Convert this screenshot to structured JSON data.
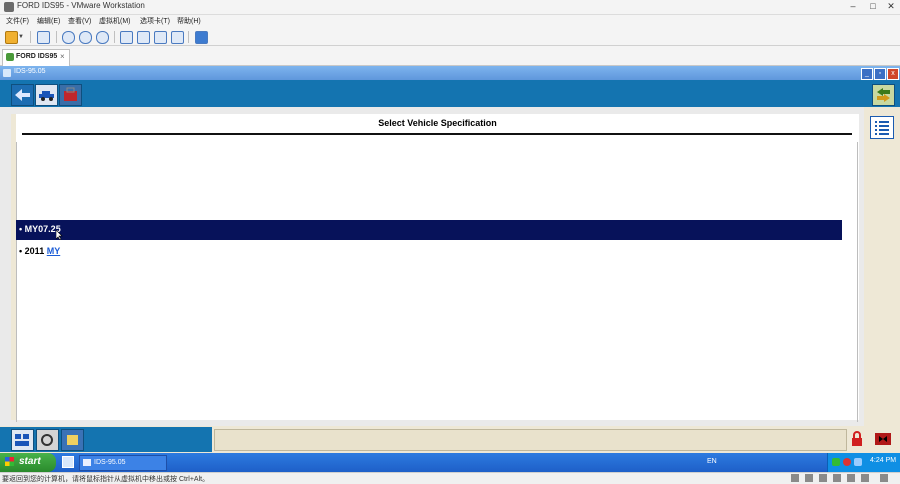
{
  "vmware": {
    "window_title": "FORD IDS95 - VMware Workstation",
    "menu": [
      "文件(F)",
      "编辑(E)",
      "查看(V)",
      "虚拟机(M)",
      "选项卡(T)",
      "帮助(H)"
    ],
    "tab_label": "FORD IDS95",
    "tab_close": "×",
    "status_text": "要返回到您的计算机，请将鼠标指针从虚拟机中移出或按 Ctrl+Alt。"
  },
  "guest": {
    "window_title": "IDS-95.05"
  },
  "ids": {
    "heading": "Select Vehicle Specification",
    "options": [
      {
        "bullet": "•",
        "text": "MY07.25",
        "selected": true
      },
      {
        "bullet": "•",
        "text": "2011",
        "link": "MY",
        "selected": false
      }
    ]
  },
  "taskbar": {
    "start_label": "start",
    "task_label": "IDS-95.05",
    "language": "EN",
    "clock": "4:24 PM"
  },
  "colors": {
    "ids_blue": "#1474b0",
    "selection_navy": "#07125a",
    "panel_beige": "#eee8d6",
    "link_blue": "#1a5bd6"
  },
  "icons": [
    "vmware-app-icon",
    "back-arrow-icon",
    "vehicle-car-icon",
    "toolbox-icon",
    "swap-arrows-icon",
    "list-menu-icon",
    "lock-icon",
    "exit-icon",
    "start-flag-icon"
  ]
}
